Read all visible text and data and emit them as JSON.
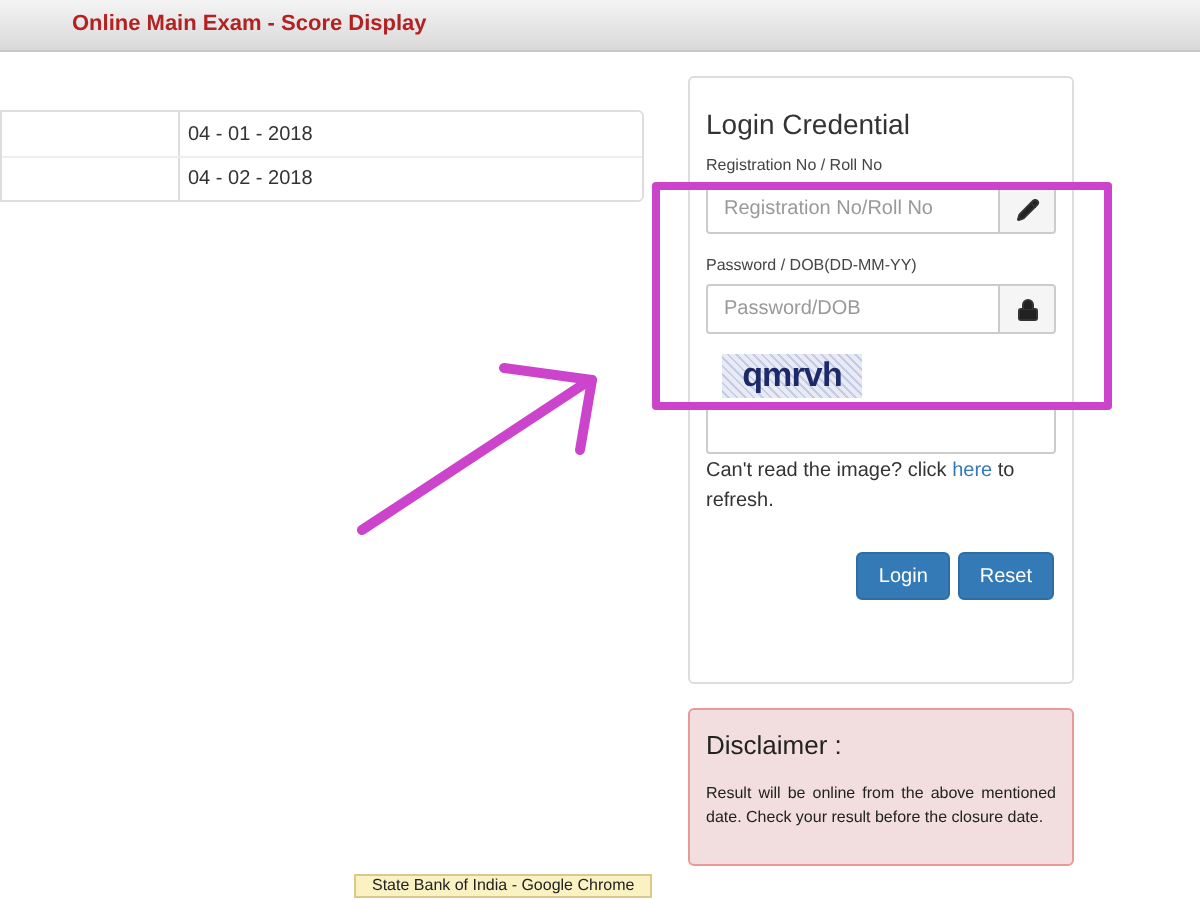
{
  "header": {
    "title": "Online Main Exam - Score Display"
  },
  "table": {
    "rows": [
      {
        "column_1": "",
        "column_2": "04 - 01 - 2018"
      },
      {
        "column_1": "",
        "column_2": "04 - 02 - 2018"
      }
    ]
  },
  "login": {
    "title": "Login Credential",
    "fields": [
      {
        "label": "Registration No / Roll No",
        "placeholder": "Registration No/Roll No",
        "kind": "pencil"
      },
      {
        "label": "Password / DOB(DD-MM-YY)",
        "placeholder": "Password/DOB",
        "kind": "lock"
      }
    ],
    "captcha": {
      "text": "qmrvh"
    },
    "hint": {
      "before": "Can't read the image? click ",
      "link": "here",
      "after": " to refresh."
    },
    "buttons": [
      "Login",
      "Reset"
    ]
  },
  "disclaimer": {
    "title": "Disclaimer :",
    "text": "Result will be online from the above mentioned date. Check your result before the closure date."
  },
  "tooltip": {
    "text": "State Bank of India - Google Chrome"
  }
}
